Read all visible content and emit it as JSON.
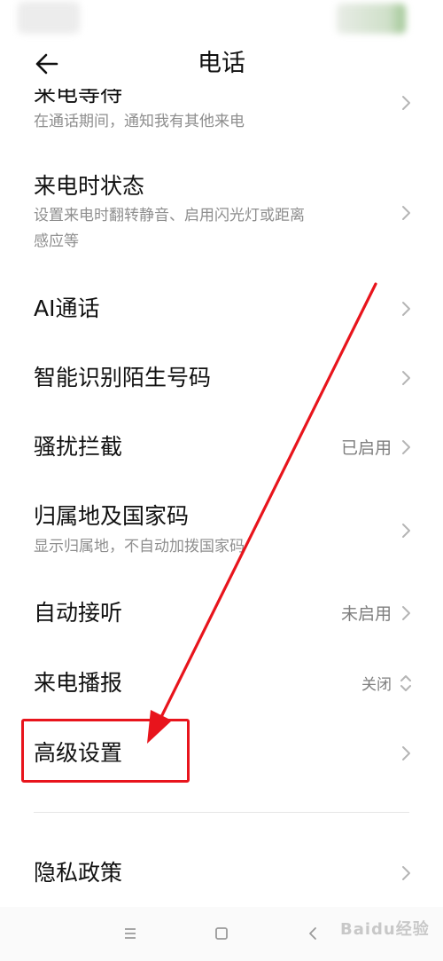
{
  "header": {
    "title": "电话"
  },
  "cut_item": {
    "subtitle": "在通话期间，通知我有其他来电"
  },
  "items": [
    {
      "title": "来电时状态",
      "subtitle_line1": "设置来电时翻转静音、启用闪光灯或距离",
      "subtitle_line2": "感应等"
    },
    {
      "title": "AI通话"
    },
    {
      "title": "智能识别陌生号码"
    },
    {
      "title": "骚扰拦截",
      "value": "已启用"
    },
    {
      "title": "归属地及国家码",
      "subtitle_line1": "显示归属地，不自动加拨国家码"
    },
    {
      "title": "自动接听",
      "value": "未启用"
    },
    {
      "title": "来电播报",
      "value": "关闭"
    },
    {
      "title": "高级设置"
    },
    {
      "title": "隐私政策"
    }
  ],
  "watermark": "Baidu经验",
  "colors": {
    "annotation_red": "#e8141c",
    "subtitle_gray": "#8e8e8e"
  },
  "icons": [
    "back-arrow-icon",
    "chevron-right-icon",
    "chevron-updown-icon",
    "menu-icon",
    "home-icon",
    "back-nav-icon"
  ]
}
